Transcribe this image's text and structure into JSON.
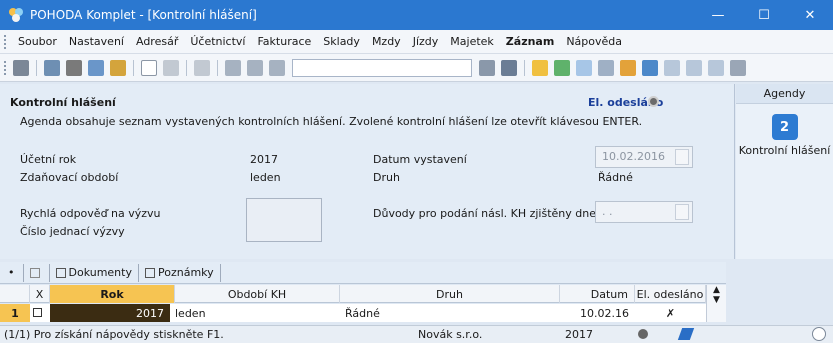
{
  "window": {
    "title": "POHODA Komplet - [Kontrolní hlášení]",
    "minimize": "—",
    "maximize": "☐",
    "close": "✕"
  },
  "menu": [
    "Soubor",
    "Nastavení",
    "Adresář",
    "Účetnictví",
    "Fakturace",
    "Sklady",
    "Mzdy",
    "Jízdy",
    "Majetek",
    "Záznam",
    "Nápověda"
  ],
  "header": {
    "title": "Kontrolní hlášení",
    "status": "El. odesláno",
    "description": "Agenda obsahuje seznam vystavených kontrolních hlášení. Zvolené kontrolní hlášení lze otevřít klávesou ENTER."
  },
  "form": {
    "ucetni_rok_label": "Účetní rok",
    "ucetni_rok_value": "2017",
    "obdobi_label": "Zdaňovací období",
    "obdobi_value": "leden",
    "datum_vystaveni_label": "Datum vystavení",
    "datum_vystaveni_value": "10.02.2016",
    "druh_label": "Druh",
    "druh_value": "Řádné",
    "rychla_odpoved_label": "Rychlá odpověď na výzvu",
    "cislo_jednaci_label": "Číslo jednací výzvy",
    "duvody_label": "Důvody pro podání násl. KH zjištěny dne",
    "duvody_value": ". ."
  },
  "sidebar": {
    "header": "Agendy",
    "item": "Kontrolní hlášení"
  },
  "tabs": [
    "Dokumenty",
    "Poznámky"
  ],
  "grid": {
    "columns": [
      "X",
      "Rok",
      "Období KH",
      "Druh",
      "Datum",
      "El. odesláno"
    ],
    "rows": [
      {
        "num": "1",
        "rok": "2017",
        "obdobi": "leden",
        "druh": "Řádné",
        "datum": "10.02.16",
        "el": "✗"
      }
    ]
  },
  "statusbar": {
    "help": "(1/1) Pro získání nápovědy stiskněte F1.",
    "company": "Novák s.r.o.",
    "year": "2017"
  }
}
